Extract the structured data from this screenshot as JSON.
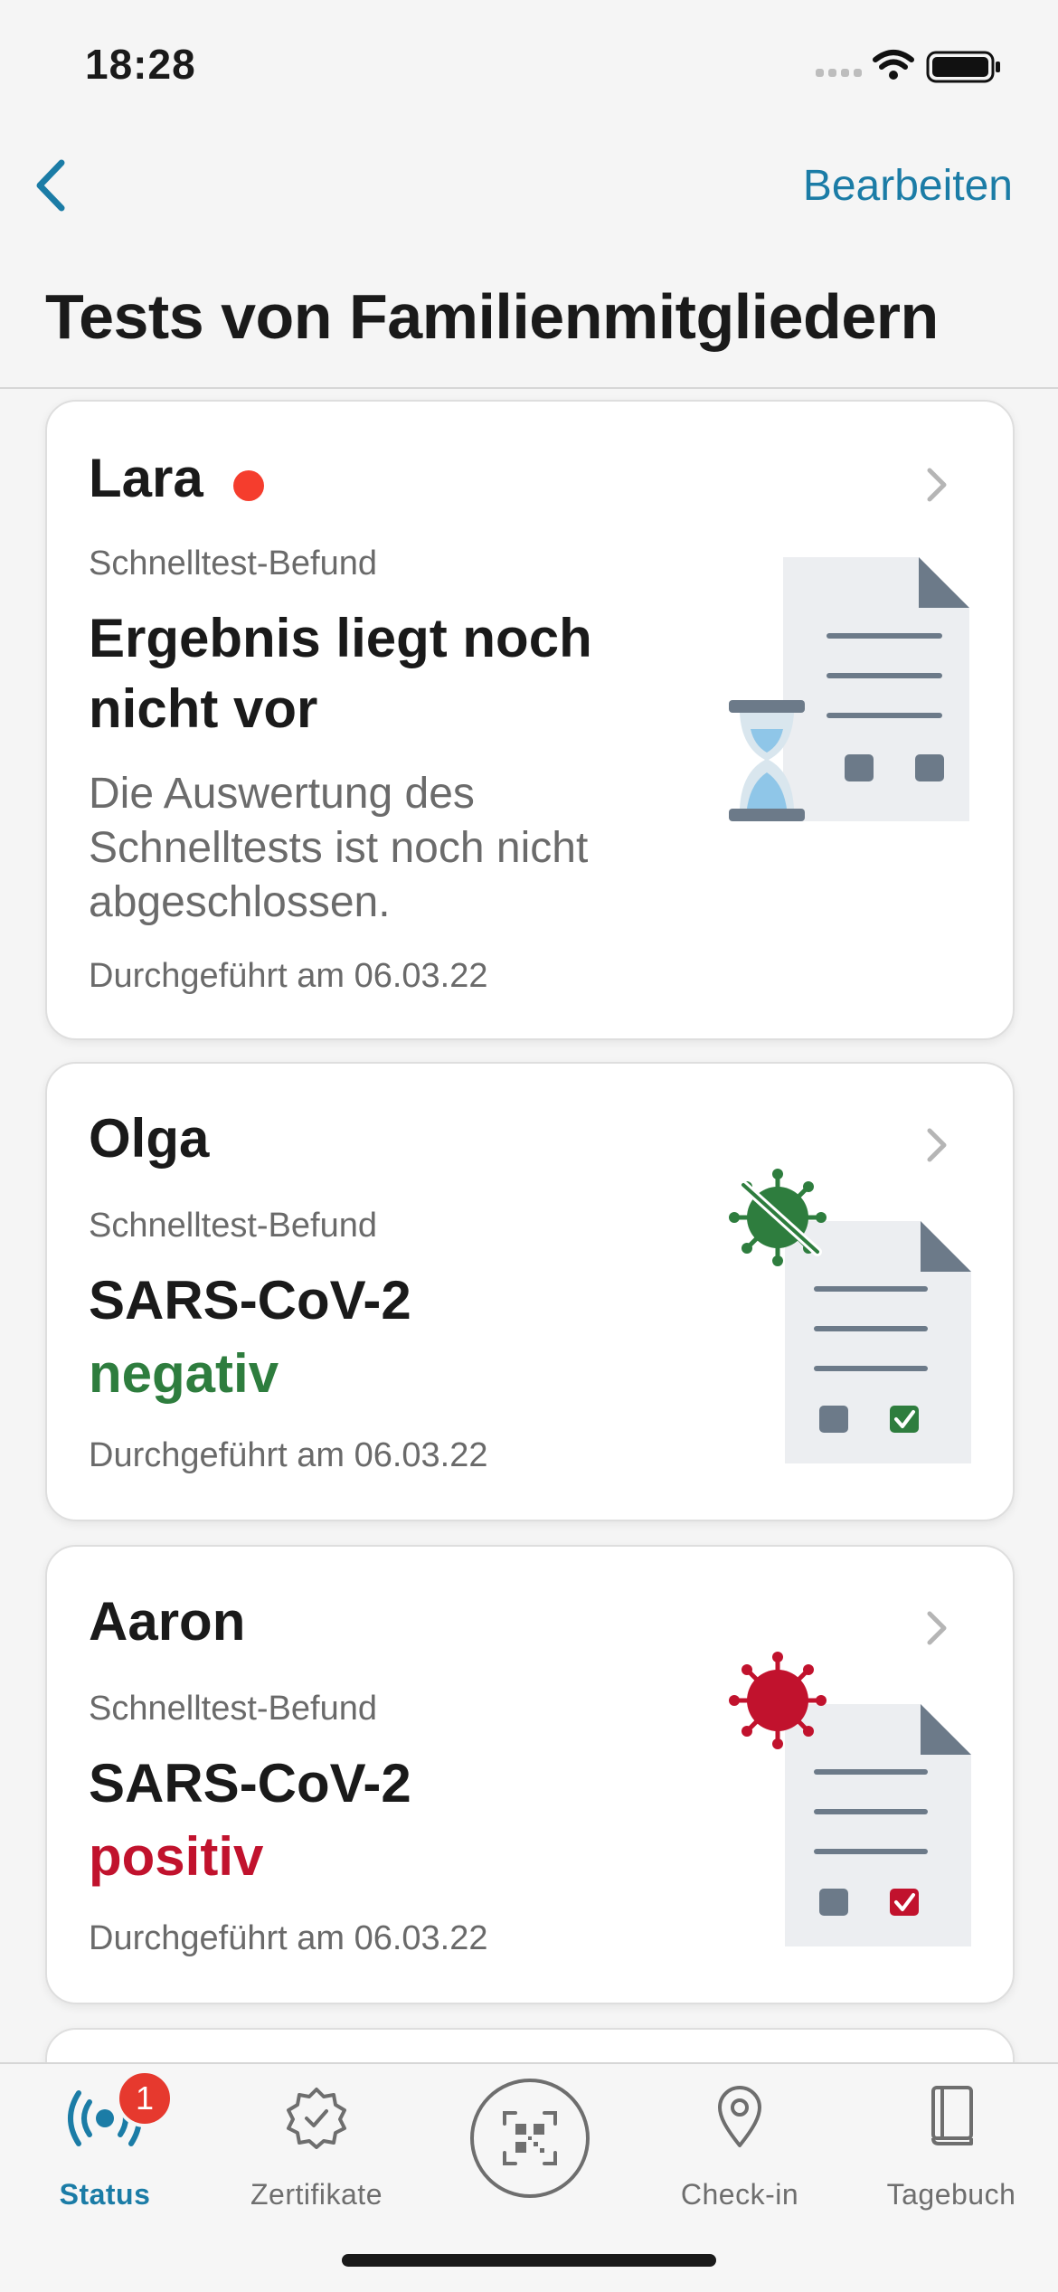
{
  "status_bar": {
    "time": "18:28"
  },
  "nav": {
    "edit_label": "Bearbeiten"
  },
  "page_title": "Tests von Familienmitgliedern",
  "cards": [
    {
      "name": "Lara",
      "unread": true,
      "kind": "Schnelltest-Befund",
      "headline_line1": "Ergebnis liegt noch",
      "headline_line2": "nicht vor",
      "description": "Die Auswertung des Schnelltests ist noch nicht abgeschlossen.",
      "date": "Durchgeführt am 06.03.22",
      "illustration": "pending-hourglass-document-icon"
    },
    {
      "name": "Olga",
      "kind": "Schnelltest-Befund",
      "headline": "SARS-CoV-2",
      "result": "negativ",
      "result_color": "#2e7d3e",
      "date": "Durchgeführt am 06.03.22",
      "illustration": "negative-virus-document-icon"
    },
    {
      "name": "Aaron",
      "kind": "Schnelltest-Befund",
      "headline": "SARS-CoV-2",
      "result": "positiv",
      "result_color": "#c1122d",
      "date": "Durchgeführt am 06.03.22",
      "illustration": "positive-virus-document-icon"
    }
  ],
  "tabbar": {
    "tabs": [
      {
        "label": "Status",
        "active": true,
        "badge": "1",
        "icon": "exposure-status-icon"
      },
      {
        "label": "Zertifikate",
        "icon": "certificate-icon"
      },
      {
        "label": "",
        "icon": "qr-scan-icon"
      },
      {
        "label": "Check-in",
        "icon": "location-pin-icon"
      },
      {
        "label": "Tagebuch",
        "icon": "diary-book-icon"
      }
    ]
  },
  "colors": {
    "accent": "#1b7ca6",
    "negative": "#2e7d3e",
    "positive": "#c1122d",
    "unread_dot": "#f53d2d"
  }
}
